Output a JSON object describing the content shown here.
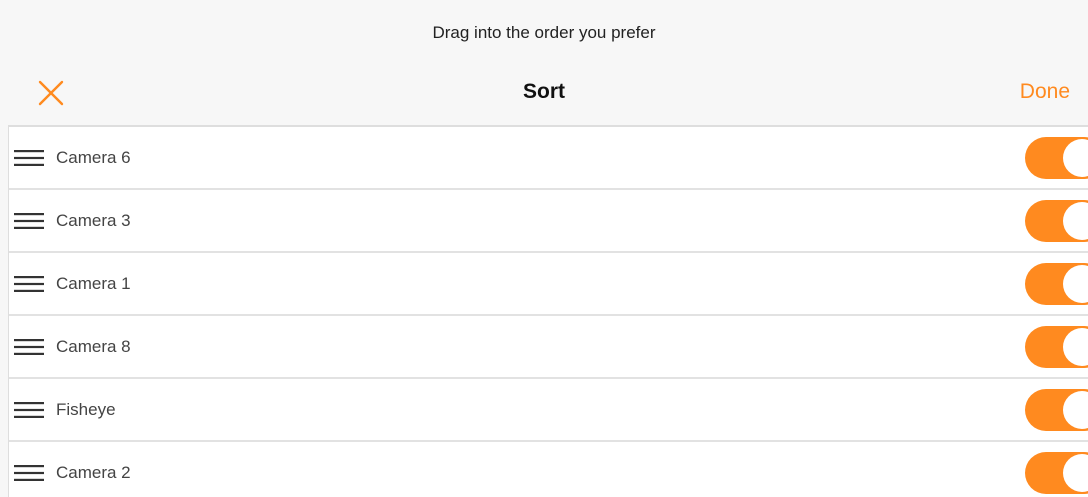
{
  "hint": "Drag into the order you prefer",
  "header": {
    "title": "Sort",
    "done_label": "Done",
    "close_icon": "close-icon"
  },
  "colors": {
    "accent": "#ff8a1f",
    "background": "#f7f7f7",
    "row_background": "#ffffff",
    "divider": "#e2e2e2"
  },
  "items": [
    {
      "label": "Camera 6",
      "enabled": true
    },
    {
      "label": "Camera 3",
      "enabled": true
    },
    {
      "label": "Camera 1",
      "enabled": true
    },
    {
      "label": "Camera 8",
      "enabled": true
    },
    {
      "label": "Fisheye",
      "enabled": true
    },
    {
      "label": "Camera 2",
      "enabled": true
    }
  ]
}
